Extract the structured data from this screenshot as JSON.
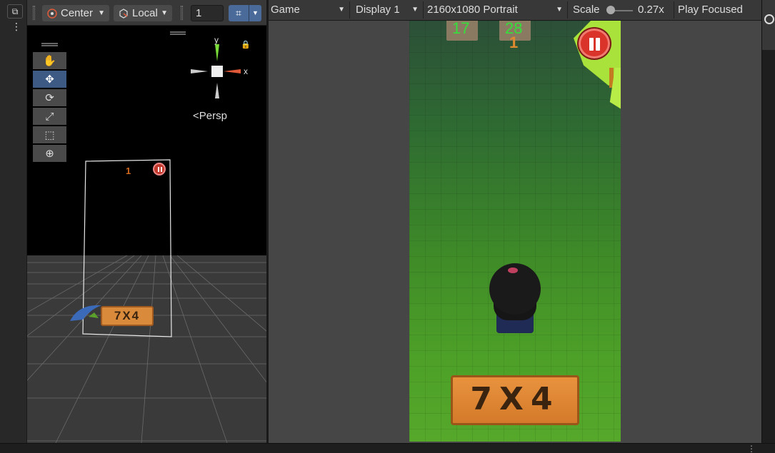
{
  "scene_toolbar": {
    "pivot_label": "Center",
    "space_label": "Local",
    "snap_value": "1",
    "persp_label": "Persp"
  },
  "scene_frame": {
    "score_label": "1",
    "sign_text": "7X4"
  },
  "game_toolbar": {
    "tab_label": "Game",
    "display_label": "Display 1",
    "resolution_label": "2160x1080 Portrait",
    "scale_label": "Scale",
    "scale_value": "0.27x",
    "play_mode_label": "Play Focused"
  },
  "game_view": {
    "score_left": "17",
    "score_right": "28",
    "score_small": "1",
    "sign_text": "7X4"
  },
  "gizmo": {
    "y_label": "y",
    "x_label": "x"
  },
  "colors": {
    "accent_blue": "#3d5a85",
    "score_green": "#35e03a",
    "pause_red": "#d9332a",
    "sign_orange": "#d98a3a"
  }
}
